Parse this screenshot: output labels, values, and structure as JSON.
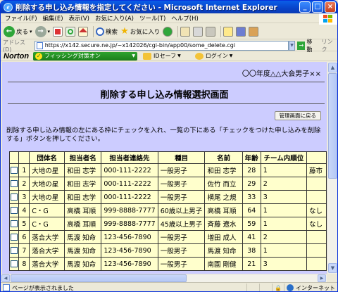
{
  "window": {
    "title": "削除する申し込み情報を指定してください - Microsoft Internet Explorer",
    "minimize": "_",
    "maximize": "□",
    "close": "×"
  },
  "menu": [
    "ファイル(F)",
    "編集(E)",
    "表示(V)",
    "お気に入り(A)",
    "ツール(T)",
    "ヘルプ(H)"
  ],
  "toolbar": {
    "back": "戻る",
    "search": "検索",
    "favorites": "お気に入り"
  },
  "address": {
    "label": "アドレス(D)",
    "url": "https://x142.secure.ne.jp/~x142026/cgi-bin/app00/some_delete.cgi",
    "go": "移動",
    "links": "リンク"
  },
  "norton": {
    "logo": "Norton",
    "phishing": "フィッシング対策オン",
    "idsafe": "IDセーフ",
    "login": "ログイン"
  },
  "page": {
    "event": "〇〇年度△△大会男子××",
    "title": "削除する申し込み情報選択画面",
    "mgmt_button": "管理画面に戻る",
    "instruction": "削除する申し込み情報の左にある枠にチェックを入れ、一覧の下にある「チェックをつけた申し込みを削除する」ボタンを押してください。"
  },
  "table": {
    "headers": [
      "",
      "",
      "団体名",
      "担当者名",
      "担当者連絡先",
      "種目",
      "名前",
      "年齢",
      "チーム内順位",
      ""
    ],
    "rows": [
      [
        "1",
        "大地の星",
        "和田 志学",
        "000-111-2222",
        "一般男子",
        "和田 志学",
        "28",
        "1",
        "藤市"
      ],
      [
        "2",
        "大地の星",
        "和田 志学",
        "000-111-2222",
        "一般男子",
        "佐竹 而立",
        "29",
        "2",
        ""
      ],
      [
        "3",
        "大地の星",
        "和田 志学",
        "000-111-2222",
        "一般男子",
        "横尾 之規",
        "33",
        "3",
        ""
      ],
      [
        "4",
        "C・G",
        "高橋 耳順",
        "999-8888-7777",
        "60歳以上男子",
        "高橋 耳順",
        "64",
        "1",
        "なし"
      ],
      [
        "5",
        "C・G",
        "高橋 耳順",
        "999-8888-7777",
        "45歳以上男子",
        "斉藤 遼水",
        "59",
        "1",
        "なし"
      ],
      [
        "6",
        "落合大学",
        "馬渡 知命",
        "123-456-7890",
        "一般男子",
        "増田 成人",
        "41",
        "2",
        ""
      ],
      [
        "7",
        "落合大学",
        "馬渡 知命",
        "123-456-7890",
        "一般男子",
        "馬渡 知命",
        "38",
        "1",
        ""
      ],
      [
        "8",
        "落合大学",
        "馬渡 知命",
        "123-456-7890",
        "一般男子",
        "南園 剛健",
        "21",
        "3",
        ""
      ]
    ]
  },
  "status": {
    "text": "ページが表示されました",
    "zone": "インターネット"
  }
}
